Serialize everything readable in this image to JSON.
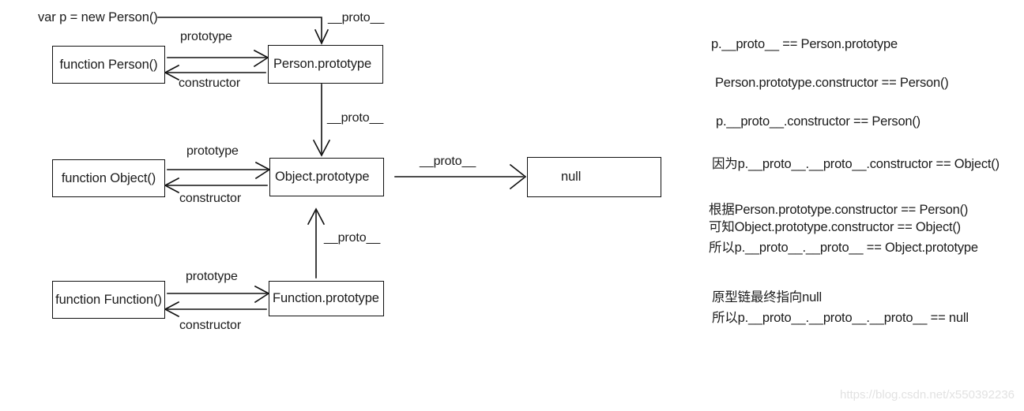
{
  "diagram": {
    "title_text": "var p = new Person()",
    "nodes": [
      {
        "id": "function-person",
        "label": "function Person()"
      },
      {
        "id": "person-prototype",
        "label": "Person.prototype"
      },
      {
        "id": "function-object",
        "label": "function Object()"
      },
      {
        "id": "object-prototype",
        "label": "Object.prototype"
      },
      {
        "id": "function-function",
        "label": "function Function()"
      },
      {
        "id": "function-prototype",
        "label": "Function.prototype"
      },
      {
        "id": "null-node",
        "label": "null"
      }
    ],
    "edge_labels": {
      "proto_top": "__proto__",
      "prototype_person": "prototype",
      "constructor_person": "constructor",
      "proto_person_to_object": "__proto__",
      "prototype_object": "prototype",
      "constructor_object": "constructor",
      "proto_object_to_null": "__proto__",
      "proto_function_to_object": "__proto__",
      "prototype_function": "prototype",
      "constructor_function": "constructor"
    },
    "stroke_color": "#101010",
    "text_color": "#1b1b1b"
  },
  "notes": {
    "lines": [
      "p.__proto__ == Person.prototype",
      "Person.prototype.constructor ==  Person()",
      "p.__proto__.constructor ==  Person()",
      "因为p.__proto__.__proto__.constructor == Object()",
      "根据Person.prototype.constructor == Person()",
      "可知Object.prototype.constructor == Object()",
      "所以p.__proto__.__proto__ == Object.prototype",
      "原型链最终指向null",
      "所以p.__proto__.__proto__.__proto__ == null"
    ]
  },
  "watermark": {
    "text": "https://blog.csdn.net/x550392236"
  }
}
